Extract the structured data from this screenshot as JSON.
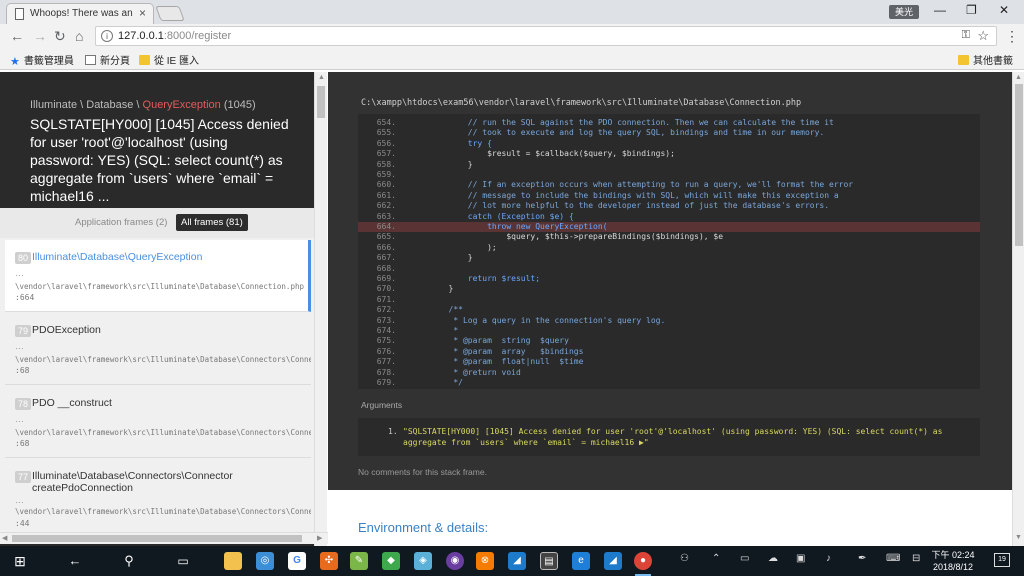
{
  "browser": {
    "tab_title": "Whoops! There was an error.",
    "tab_close": "×",
    "user_badge": "美光",
    "url_host": "127.0.0.1",
    "url_rest": ":8000/register",
    "bookmarks": [
      {
        "label": "書籤管理員",
        "icon": "star-icon"
      },
      {
        "label": "新分頁",
        "icon": "page-icon"
      },
      {
        "label": "從 IE 匯入",
        "icon": "folder-icon"
      }
    ],
    "other_bookmarks": "其他書籤"
  },
  "exception": {
    "namespace": "Illuminate \\ Database \\ ",
    "class_name": "QueryException",
    "code": "(1045)",
    "message": "SQLSTATE[HY000] [1045] Access denied for user 'root'@'localhost' (using password: YES) (SQL: select count(*) as aggregate from `users` where `email` = michael16 ..."
  },
  "frame_tabs": {
    "application": "Application frames (2)",
    "all": "All frames (81)"
  },
  "frames": [
    {
      "num": "80",
      "name": "Illuminate\\Database\\QueryException",
      "dots": "…",
      "path": "\\vendor\\laravel\\framework\\src\\Illuminate\\Database\\Connection.php",
      "line": ":664",
      "active": true
    },
    {
      "num": "79",
      "name": "PDOException",
      "dots": "…",
      "path": "\\vendor\\laravel\\framework\\src\\Illuminate\\Database\\Connectors\\Connector.php",
      "line": ":68",
      "active": false
    },
    {
      "num": "78",
      "name": "PDO __construct",
      "dots": "…",
      "path": "\\vendor\\laravel\\framework\\src\\Illuminate\\Database\\Connectors\\Connector.php",
      "line": ":68",
      "active": false
    },
    {
      "num": "77",
      "name": "Illuminate\\Database\\Connectors\\Connector createPdoConnection",
      "dots": "…",
      "path": "\\vendor\\laravel\\framework\\src\\Illuminate\\Database\\Connectors\\Connector.php",
      "line": ":44",
      "active": false
    }
  ],
  "code": {
    "file_path": "C:\\xampp\\htdocs\\exam56\\vendor\\laravel\\framework\\src\\Illuminate\\Database\\Connection.php",
    "lines": [
      {
        "n": "654.",
        "t": "            // run the SQL against the PDO connection. Then we can calculate the time it",
        "k": "cm"
      },
      {
        "n": "655.",
        "t": "            // took to execute and log the query SQL, bindings and time in our memory.",
        "k": "cm"
      },
      {
        "n": "656.",
        "t": "            try {",
        "k": "kw"
      },
      {
        "n": "657.",
        "t": "                $result = $callback($query, $bindings);",
        "k": "vr"
      },
      {
        "n": "658.",
        "t": "            }",
        "k": "vr"
      },
      {
        "n": "659.",
        "t": "",
        "k": "vr"
      },
      {
        "n": "660.",
        "t": "            // If an exception occurs when attempting to run a query, we'll format the error",
        "k": "cm"
      },
      {
        "n": "661.",
        "t": "            // message to include the bindings with SQL, which will make this exception a",
        "k": "cm"
      },
      {
        "n": "662.",
        "t": "            // lot more helpful to the developer instead of just the database's errors.",
        "k": "cm"
      },
      {
        "n": "663.",
        "t": "            catch (Exception $e) {",
        "k": "kw"
      },
      {
        "n": "664.",
        "t": "                throw new QueryException(",
        "k": "hl"
      },
      {
        "n": "665.",
        "t": "                    $query, $this->prepareBindings($bindings), $e",
        "k": "vr"
      },
      {
        "n": "666.",
        "t": "                );",
        "k": "vr"
      },
      {
        "n": "667.",
        "t": "            }",
        "k": "vr"
      },
      {
        "n": "668.",
        "t": "",
        "k": "vr"
      },
      {
        "n": "669.",
        "t": "            return $result;",
        "k": "kw"
      },
      {
        "n": "670.",
        "t": "        }",
        "k": "vr"
      },
      {
        "n": "671.",
        "t": "",
        "k": "vr"
      },
      {
        "n": "672.",
        "t": "        /**",
        "k": "cm"
      },
      {
        "n": "673.",
        "t": "         * Log a query in the connection's query log.",
        "k": "cm"
      },
      {
        "n": "674.",
        "t": "         *",
        "k": "cm"
      },
      {
        "n": "675.",
        "t": "         * @param  string  $query",
        "k": "cm"
      },
      {
        "n": "676.",
        "t": "         * @param  array   $bindings",
        "k": "cm"
      },
      {
        "n": "677.",
        "t": "         * @param  float|null  $time",
        "k": "cm"
      },
      {
        "n": "678.",
        "t": "         * @return void",
        "k": "cm"
      },
      {
        "n": "679.",
        "t": "         */",
        "k": "cm"
      }
    ]
  },
  "arguments": {
    "label": "Arguments",
    "number": "1.",
    "text": "\"SQLSTATE[HY000] [1045] Access denied for user 'root'@'localhost' (using password: YES) (SQL: select count(*) as aggregate from `users` where `email` = michael16 ▶\""
  },
  "no_comments": "No comments for this stack frame.",
  "env_heading": "Environment & details:",
  "taskbar": {
    "time": "下午 02:24",
    "date": "2018/8/12",
    "notifications": "19"
  },
  "colors": {
    "accent": "#4a90e2",
    "exception_class": "#e35b5b",
    "highlight_line": "#5a3434",
    "argument_text": "#d8d863"
  }
}
